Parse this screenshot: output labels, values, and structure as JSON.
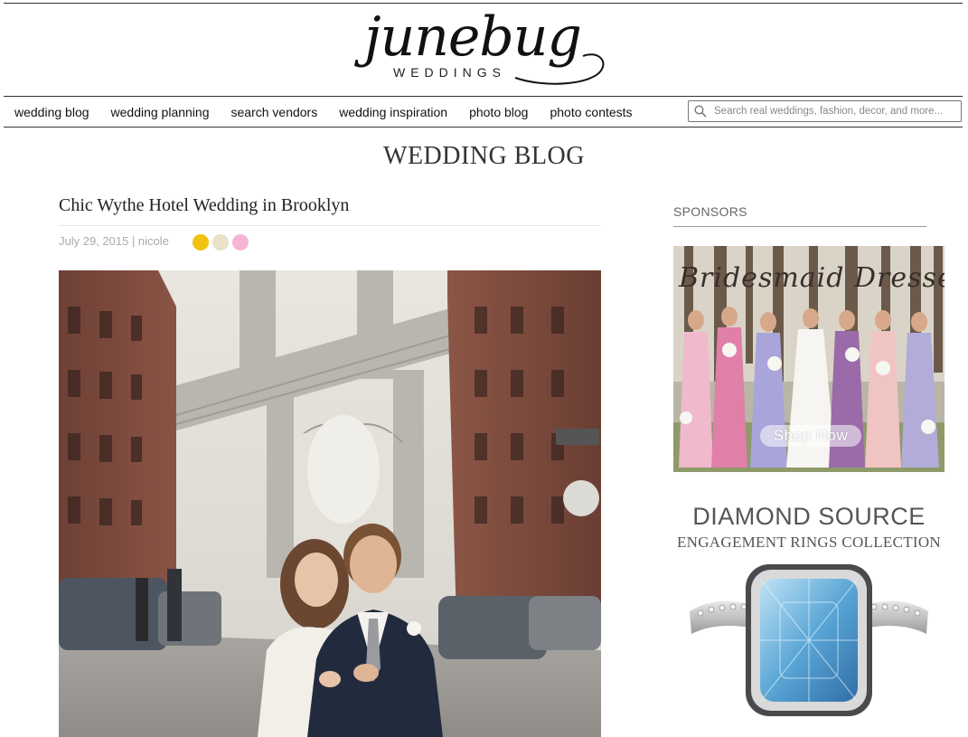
{
  "logo": {
    "script": "junebug",
    "sub": "WEDDINGS"
  },
  "nav": {
    "items": [
      "wedding blog",
      "wedding planning",
      "search vendors",
      "wedding inspiration",
      "photo blog",
      "photo contests"
    ],
    "search_placeholder": "Search real weddings, fashion, decor, and more..."
  },
  "page": {
    "heading": "WEDDING BLOG"
  },
  "post": {
    "title": "Chic Wythe Hotel Wedding in Brooklyn",
    "meta": "July 29, 2015 | nicole",
    "palette": [
      "#f2c20f",
      "#e9e1c8",
      "#f4b6d3"
    ]
  },
  "sidebar": {
    "sponsors_label": "SPONSORS",
    "ad1": {
      "title": "Bridesmaid Dresses",
      "button": "Shop Now"
    },
    "ad2": {
      "title": "DIAMOND SOURCE",
      "subtitle": "ENGAGEMENT RINGS COLLECTION"
    }
  },
  "colors": {
    "text": "#222222",
    "meta": "#aaaaaa",
    "rule": "#333333"
  },
  "icons": {
    "search": "search-icon"
  }
}
